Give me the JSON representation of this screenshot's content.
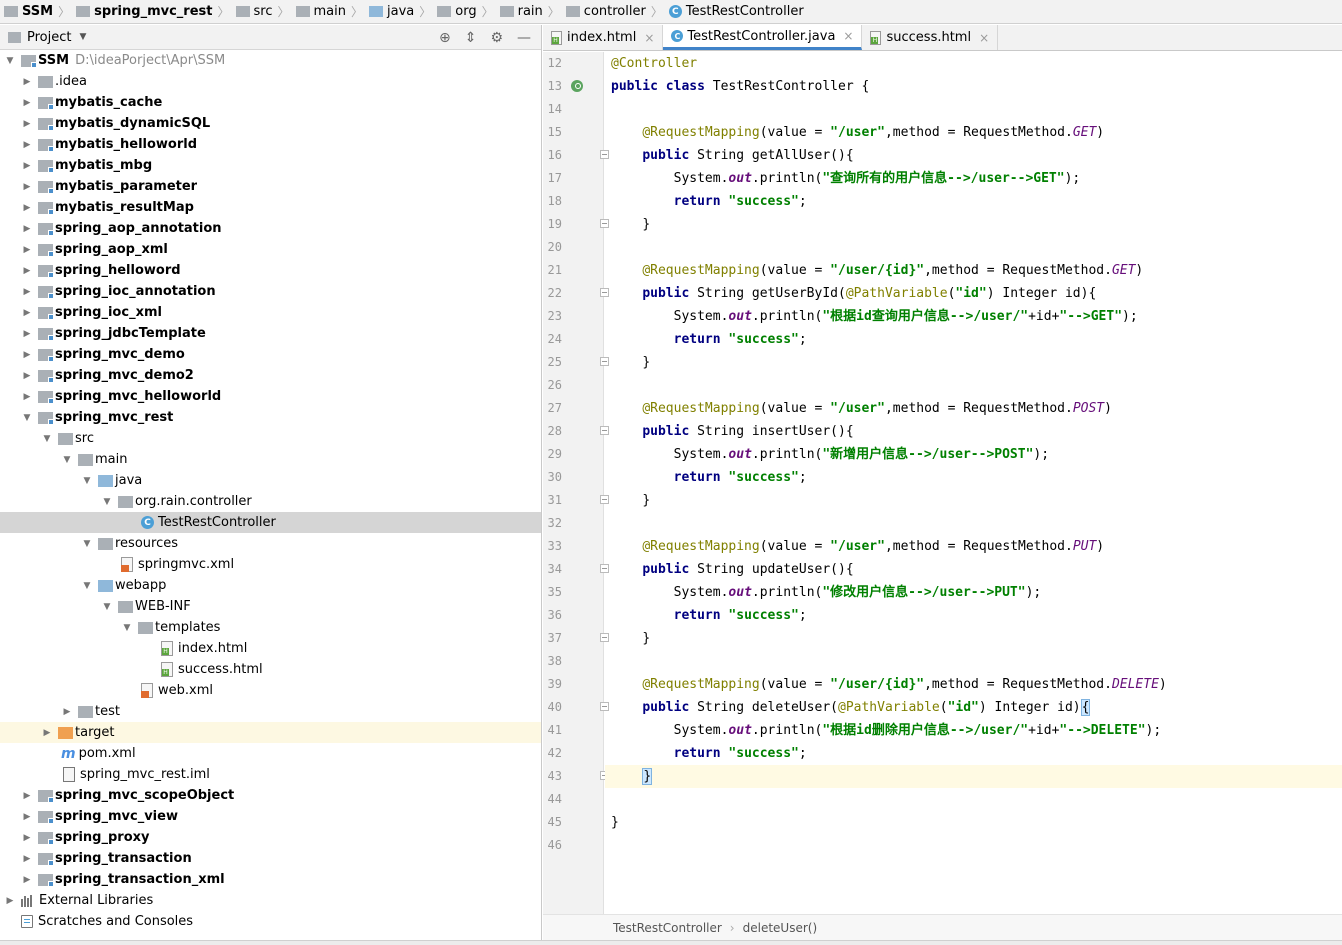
{
  "navbar": {
    "crumbs": [
      "SSM",
      "spring_mvc_rest",
      "src",
      "main",
      "java",
      "org",
      "rain",
      "controller",
      "TestRestController"
    ]
  },
  "project_panel": {
    "title": "Project",
    "root_name": "SSM",
    "root_path": "D:\\ideaPorject\\Apr\\SSM",
    "items": [
      ".idea",
      "mybatis_cache",
      "mybatis_dynamicSQL",
      "mybatis_helloworld",
      "mybatis_mbg",
      "mybatis_parameter",
      "mybatis_resultMap",
      "spring_aop_annotation",
      "spring_aop_xml",
      "spring_helloword",
      "spring_ioc_annotation",
      "spring_ioc_xml",
      "spring_jdbcTemplate",
      "spring_mvc_demo",
      "spring_mvc_demo2",
      "spring_mvc_helloworld",
      "spring_mvc_rest",
      "src",
      "main",
      "java",
      "org.rain.controller",
      "TestRestController",
      "resources",
      "springmvc.xml",
      "webapp",
      "WEB-INF",
      "templates",
      "index.html",
      "success.html",
      "web.xml",
      "test",
      "target",
      "pom.xml",
      "spring_mvc_rest.iml",
      "spring_mvc_scopeObject",
      "spring_mvc_view",
      "spring_proxy",
      "spring_transaction",
      "spring_transaction_xml",
      "External Libraries",
      "Scratches and Consoles"
    ]
  },
  "editor": {
    "tabs": [
      "index.html",
      "TestRestController.java",
      "success.html"
    ],
    "active_tab": "TestRestController.java",
    "line_numbers": [
      "12",
      "13",
      "14",
      "15",
      "16",
      "17",
      "18",
      "19",
      "20",
      "21",
      "22",
      "23",
      "24",
      "25",
      "26",
      "27",
      "28",
      "29",
      "30",
      "31",
      "32",
      "33",
      "34",
      "35",
      "36",
      "37",
      "38",
      "39",
      "40",
      "41",
      "42",
      "43",
      "44",
      "45",
      "46"
    ],
    "code": {
      "l12_ann": "@Controller",
      "kw_public": "public",
      "kw_class": "class",
      "kw_return": "return",
      "class_decl_rest": " TestRestController {",
      "ann_mapping": "@RequestMapping",
      "ann_pathvar": "@PathVariable",
      "value_eq": "(value = ",
      "method_eq": ",method = RequestMethod.",
      "str_user": "\"/user\"",
      "str_user_id": "\"/user/{id}\"",
      "str_id": "\"id\"",
      "str_success": "\"success\"",
      "get": "GET",
      "post": "POST",
      "put": "PUT",
      "delete": "DELETE",
      "sig_getAll": " String getAllUser(){",
      "sig_getById_pre": " String getUserById(",
      "sig_getById_post": ") Integer id){",
      "sig_insert": " String insertUser(){",
      "sig_update": " String updateUser(){",
      "sig_delete_pre": " String deleteUser(",
      "sig_delete_post": ") Integer id)",
      "sysout_pre": "System.",
      "out": "out",
      "println": ".println(",
      "msg_getAll": "\"查询所有的用户信息-->/user-->GET\"",
      "msg_getById_a": "\"根据id查询用户信息-->/user/\"",
      "msg_getById_b": "\"-->GET\"",
      "msg_insert": "\"新增用户信息-->/user-->POST\"",
      "msg_update": "\"修改用户信息-->/user-->PUT\"",
      "msg_delete_a": "\"根据id删除用户信息-->/user/\"",
      "msg_delete_b": "\"-->DELETE\"",
      "plus_id_plus": "+id+",
      "close_paren_semi": ");",
      "semi": ";",
      "close_paren": ")",
      "open_brace": "{",
      "close_brace": "}"
    },
    "breadcrumb": [
      "TestRestController",
      "deleteUser()"
    ]
  },
  "colors": {
    "keyword": "#000080",
    "annotation": "#808000",
    "string": "#008000",
    "static_field": "#660e7a",
    "selection": "#d5d5d5",
    "caret_row": "#fffae3"
  }
}
